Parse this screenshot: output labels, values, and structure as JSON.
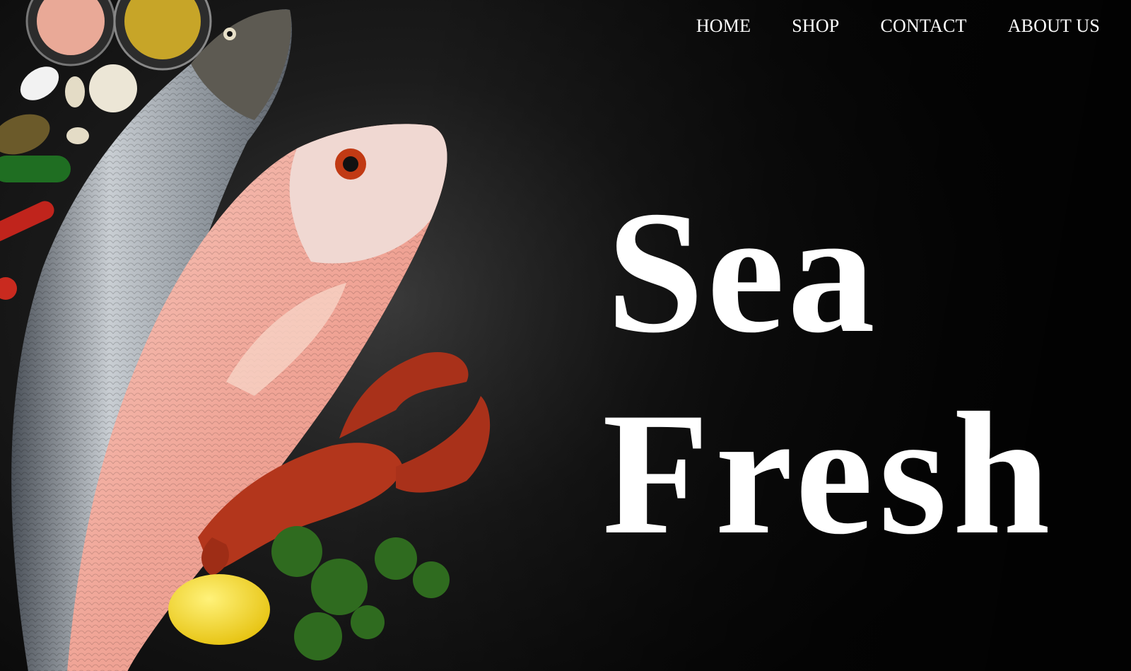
{
  "nav": {
    "items": [
      {
        "label": "HOME"
      },
      {
        "label": "SHOP"
      },
      {
        "label": "CONTACT"
      },
      {
        "label": "ABOUT US"
      }
    ]
  },
  "hero": {
    "title_line1": "Sea",
    "title_line2": "Fresh",
    "image_subject": "fresh-seafood-photo",
    "colors": {
      "background": "#1a1a1a",
      "text": "#ffffff",
      "salmon_skin": "#9aa0a6",
      "snapper_skin": "#f2b3a6",
      "lobster": "#b3361c",
      "lemon": "#f2d21b",
      "parsley": "#2f6b1f"
    }
  }
}
